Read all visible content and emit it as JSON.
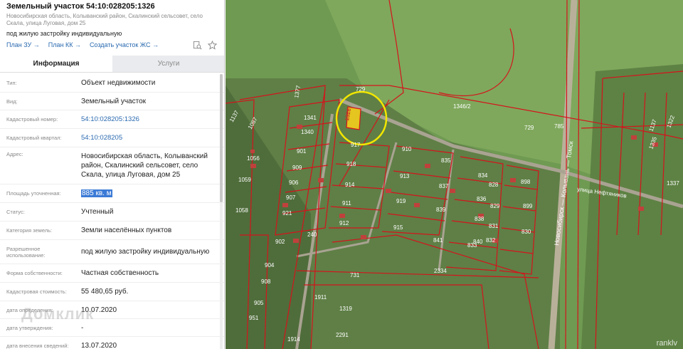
{
  "header": {
    "title": "Земельный участок 54:10:028205:1326",
    "address": "Новосибирская область, Колыванский район, Скалинский сельсовет, село Скала, улица Луговая, дом 25",
    "purpose": "под жилую застройку индивидуальную"
  },
  "links": [
    {
      "label": "План ЗУ →"
    },
    {
      "label": "План КК →"
    },
    {
      "label": "Создать участок ЖС →"
    }
  ],
  "tabs": {
    "info": "Информация",
    "services": "Услуги"
  },
  "rows": [
    {
      "label": "Тип:",
      "value": "Объект недвижимости"
    },
    {
      "label": "Вид:",
      "value": "Земельный участок"
    },
    {
      "label": "Кадастровый номер:",
      "value": "54:10:028205:1326"
    },
    {
      "label": "Кадастровый квартал:",
      "value": "54:10:028205"
    },
    {
      "label": "Адрес:",
      "value": "Новосибирская область, Колыванский район, Скалинский сельсовет, село Скала, улица Луговая, дом 25"
    },
    {
      "label": "Площадь уточненная:",
      "value": "885 кв. м"
    },
    {
      "label": "Статус:",
      "value": "Учтенный"
    },
    {
      "label": "Категория земель:",
      "value": "Земли населённых пунктов"
    },
    {
      "label": "Разрешенное использование:",
      "value": "под жилую застройку индивидуальную"
    },
    {
      "label": "Форма собственности:",
      "value": "Частная собственность"
    },
    {
      "label": "Кадастровая стоимость:",
      "value": "55 480,65 руб."
    },
    {
      "label": "дата определения:",
      "value": "10.07.2020"
    },
    {
      "label": "дата утверждения:",
      "value": "-"
    },
    {
      "label": "дата внесения сведений:",
      "value": "13.07.2020"
    }
  ],
  "watermarks": {
    "domclick": "Домклик",
    "rankly": "ranklv"
  },
  "map": {
    "road_label_1": "Новосибирск — Колывань — Томск",
    "road_label_2": "улица Нефтяников",
    "parcels": [
      "1326",
      "729",
      "1346/2",
      "729",
      "1377",
      "1341",
      "1340",
      "901",
      "909",
      "906",
      "907",
      "921",
      "918",
      "914",
      "911",
      "912",
      "910",
      "913",
      "919",
      "915",
      "835",
      "837",
      "839",
      "841",
      "834",
      "836",
      "838",
      "840",
      "833",
      "828",
      "829",
      "831",
      "832",
      "898",
      "899",
      "830",
      "902",
      "904",
      "908",
      "1056",
      "1059",
      "1058",
      "1137",
      "1087",
      "917",
      "240",
      "731",
      "2334",
      "1911",
      "951",
      "905",
      "2291",
      "1914",
      "1319",
      "785",
      "1137",
      "1322",
      "1335",
      "1337"
    ]
  },
  "colors": {
    "accent": "#2a6ab0",
    "highlight": "#3b7ad6",
    "parcel_stroke": "#d4141c",
    "selected_circle": "#f2e600"
  }
}
